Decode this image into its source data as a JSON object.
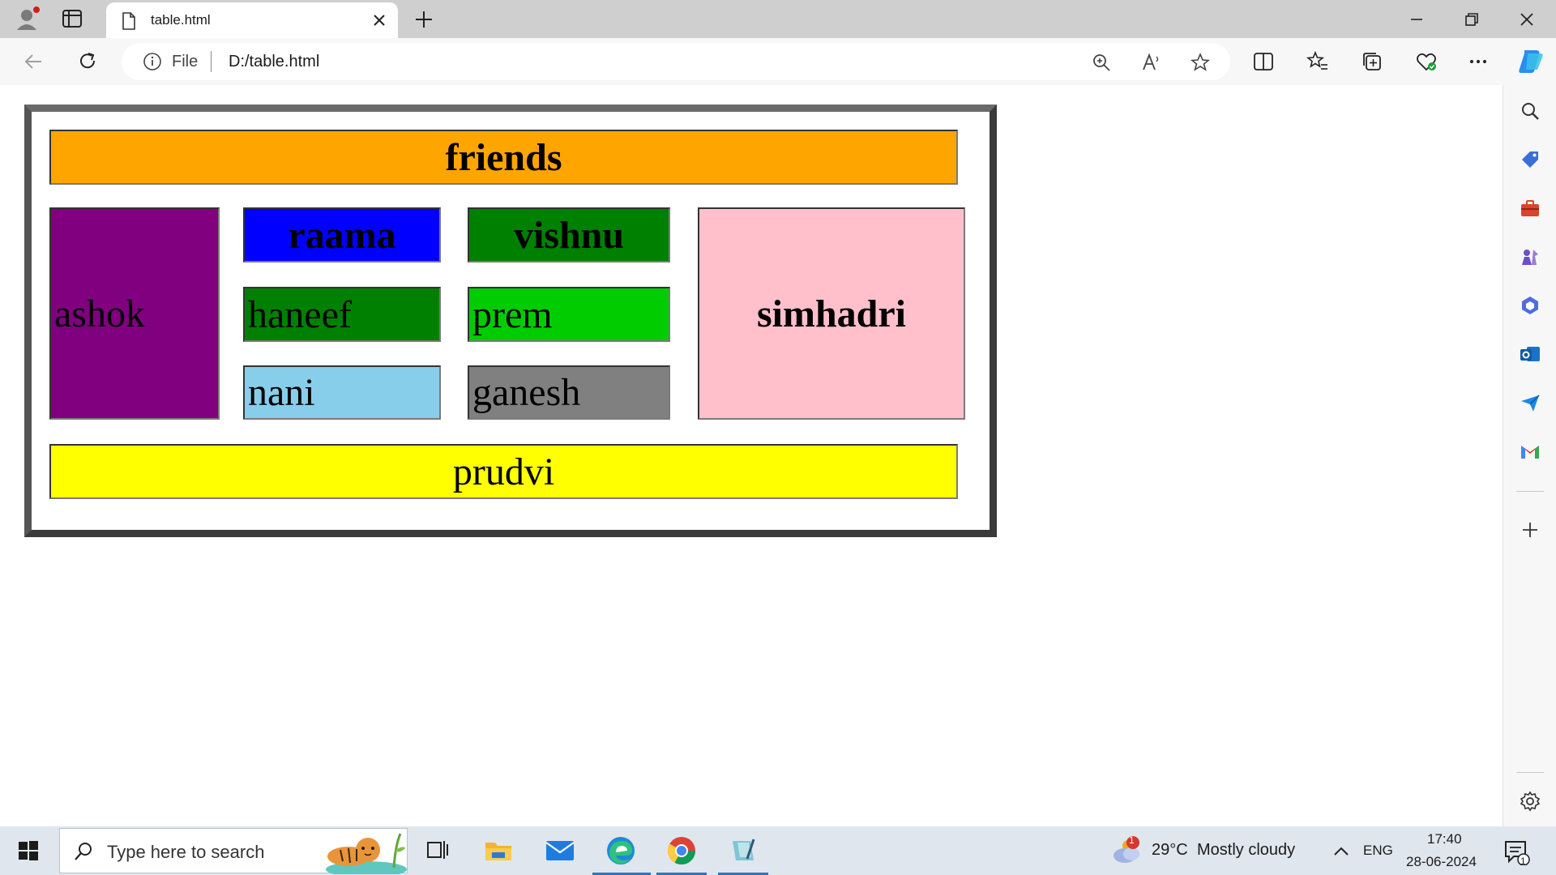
{
  "browser": {
    "tab_title": "table.html",
    "address_scheme": "File",
    "address_url": "D:/table.html"
  },
  "page": {
    "header_cell": "friends",
    "left_cell": "ashok",
    "grid": [
      {
        "label": "raama",
        "color": "#0000ff",
        "bold": true
      },
      {
        "label": "vishnu",
        "color": "#008000",
        "bold": true
      },
      {
        "label": "haneef",
        "color": "#008000",
        "bold": false
      },
      {
        "label": "prem",
        "color": "#00cc00",
        "bold": false
      },
      {
        "label": "nani",
        "color": "#87ceeb",
        "bold": false
      },
      {
        "label": "ganesh",
        "color": "#808080",
        "bold": false
      }
    ],
    "right_cell": "simhadri",
    "footer_cell": "prudvi",
    "colors": {
      "header": "#ffa500",
      "left": "#800080",
      "right": "#ffc0cb",
      "footer": "#ffff00"
    }
  },
  "taskbar": {
    "search_placeholder": "Type here to search",
    "weather_temp": "29°C",
    "weather_desc": "Mostly cloudy",
    "weather_badge": "1",
    "language": "ENG",
    "time": "17:40",
    "date": "28-06-2024",
    "notification_count": "1"
  }
}
